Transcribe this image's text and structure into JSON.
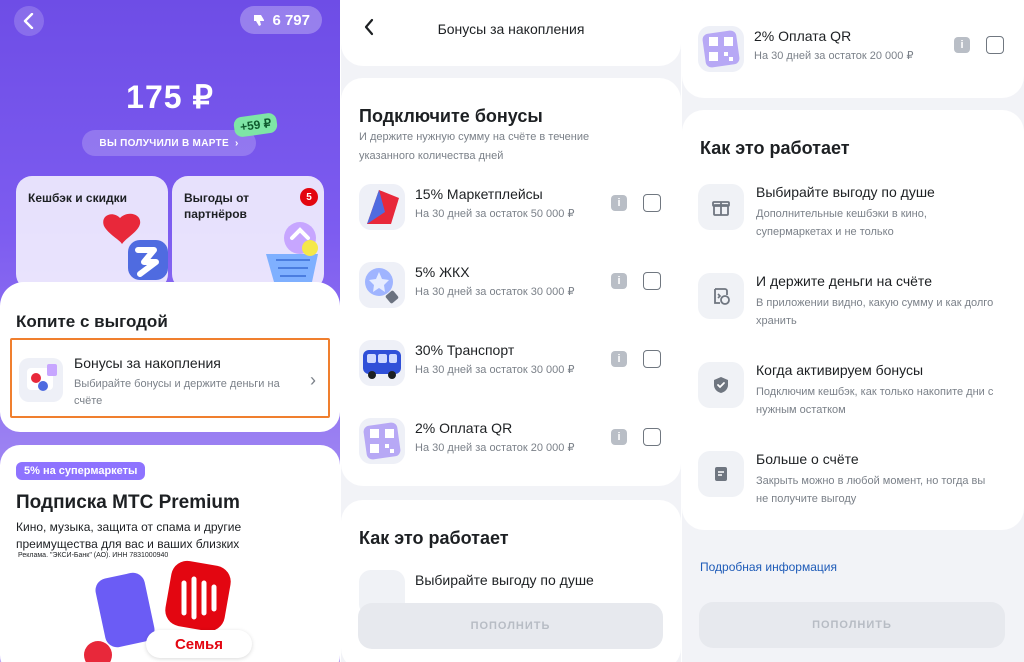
{
  "screen1": {
    "points": "6 797",
    "amount": "175 ₽",
    "received_label": "ВЫ ПОЛУЧИЛИ В МАРТЕ",
    "plus_badge": "+59 ₽",
    "cards": [
      {
        "title": "Кешбэк и скидки"
      },
      {
        "title": "Выгоды от партнёров",
        "badge": "5"
      }
    ],
    "savings_title": "Копите с выгодой",
    "bonus_item": {
      "title": "Бонусы за накопления",
      "subtitle": "Выбирайте бонусы и держите деньги на счёте"
    },
    "ad": {
      "chip": "5% на супермаркеты",
      "title": "Подписка МТС Premium",
      "desc": "Кино, музыка, защита от спама и другие преимущества для вас и ваших близких",
      "legal": "Реклама. \"ЭКСИ-Банк\" (АО). ИНН 7831000940",
      "semya": "Семья"
    }
  },
  "screen2": {
    "header_title": "Бонусы за накопления",
    "connect_title": "Подключите бонусы",
    "connect_sub": "И держите нужную сумму на счёте в течение указанного количества дней",
    "offers": [
      {
        "name": "15% Маркетплейсы",
        "cond": "На 30 дней за остаток 50 000 ₽"
      },
      {
        "name": "5% ЖКХ",
        "cond": "На 30 дней за остаток 30 000 ₽"
      },
      {
        "name": "30% Транспорт",
        "cond": "На 30 дней за остаток 30 000 ₽"
      },
      {
        "name": "2% Оплата QR",
        "cond": "На 30 дней за остаток 20 000 ₽"
      }
    ],
    "how_title": "Как это работает",
    "how_first": "Выбирайте выгоду по душе",
    "button": "ПОПОЛНИТЬ"
  },
  "screen3": {
    "top_offer": {
      "name": "2% Оплата QR",
      "cond": "На 30 дней за остаток 20 000 ₽"
    },
    "how_title": "Как это работает",
    "items": [
      {
        "title": "Выбирайте выгоду по душе",
        "desc": "Дополнительные кешбэки в кино, супермаркетах и не только",
        "icon": "gift-icon"
      },
      {
        "title": "И держите деньги на счёте",
        "desc": "В приложении видно, какую сумму и как долго хранить",
        "icon": "clock-money-icon"
      },
      {
        "title": "Когда активируем бонусы",
        "desc": "Подключим кешбэк, как только накопите дни с нужным остатком",
        "icon": "shield-check-icon"
      },
      {
        "title": "Больше о счёте",
        "desc": "Закрыть можно в любой момент, но тогда вы не получите выгоду",
        "icon": "document-icon"
      }
    ],
    "link": "Подробная информация",
    "button": "ПОПОЛНИТЬ"
  },
  "colors": {
    "accent_purple": "#7d5cf0",
    "mts_red": "#e30611",
    "highlight_orange": "#f07f2e",
    "link_blue": "#1e5bb8"
  }
}
